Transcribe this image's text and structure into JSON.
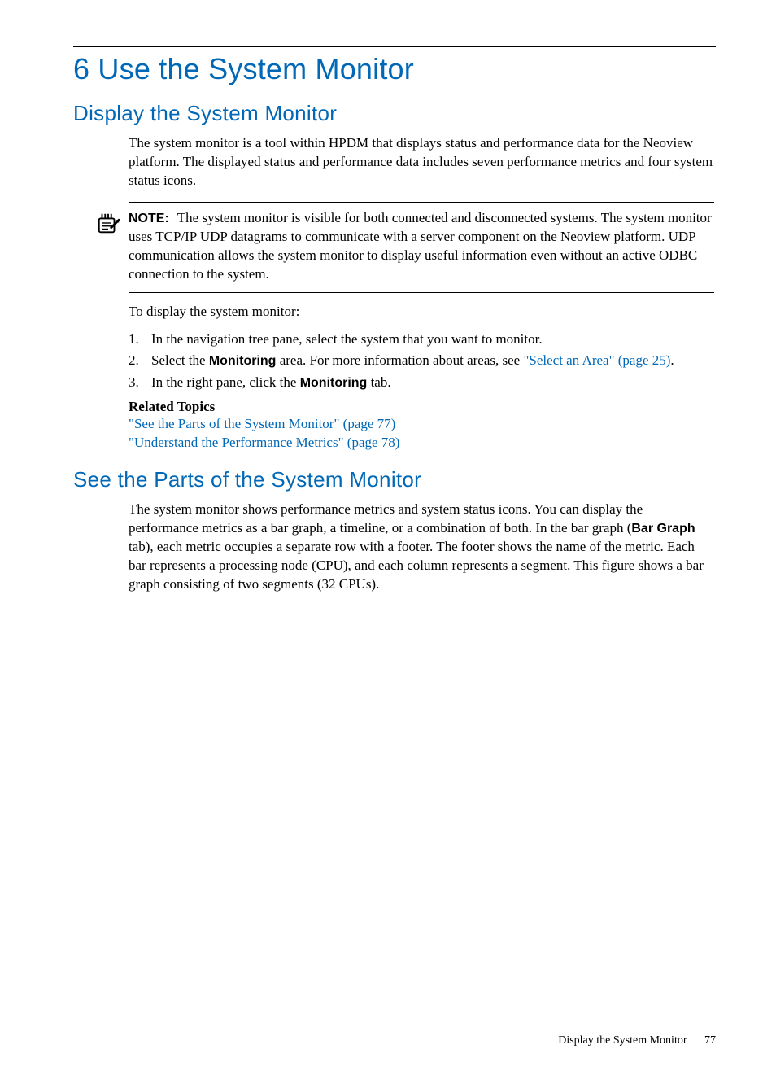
{
  "chapter": {
    "title": "6 Use the System Monitor"
  },
  "section1": {
    "title": "Display the System Monitor",
    "intro": "The system monitor is a tool within HPDM that displays status and performance data for the Neoview platform. The displayed status and performance data includes seven performance metrics and four system status icons.",
    "note_label": "NOTE:",
    "note_body": "The system monitor is visible for both connected and disconnected systems. The system monitor uses TCP/IP UDP datagrams to communicate with a server component on the Neoview platform. UDP communication allows the system monitor to display useful information even without an active ODBC connection to the system.",
    "steps_lead": "To display the system monitor:",
    "steps": {
      "n1": "1.",
      "s1": "In the navigation tree pane, select the system that you want to monitor.",
      "n2": "2.",
      "s2a": "Select the ",
      "s2b": "Monitoring",
      "s2c": " area. For more information about areas, see ",
      "s2link": "\"Select an Area\" (page 25)",
      "s2d": ".",
      "n3": "3.",
      "s3a": "In the right pane, click the ",
      "s3b": "Monitoring",
      "s3c": " tab."
    },
    "related_title": "Related Topics",
    "related1": "\"See the Parts of the System Monitor\" (page 77)",
    "related2": "\"Understand the Performance Metrics\" (page 78)"
  },
  "section2": {
    "title": "See the Parts of the System Monitor",
    "p1a": "The system monitor shows performance metrics and system status icons. You can display the performance metrics as a bar graph, a timeline, or a combination of both. In the bar graph (",
    "p1b": "Bar Graph",
    "p1c": " tab), each metric occupies a separate row with a footer. The footer shows the name of the metric. Each bar represents a processing node (CPU), and each column represents a segment. This figure shows a bar graph consisting of two segments (32 CPUs)."
  },
  "footer": {
    "text": "Display the System Monitor",
    "page": "77"
  }
}
